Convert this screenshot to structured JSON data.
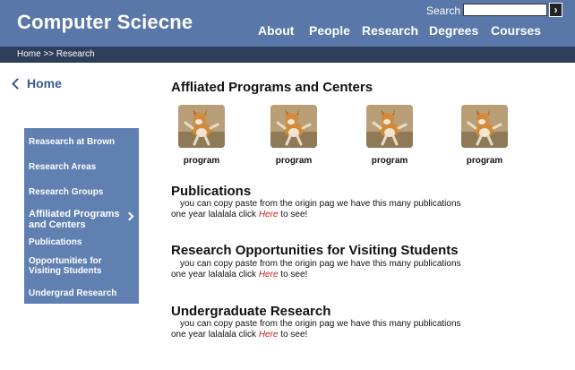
{
  "header": {
    "site_title": "Computer Sciecne",
    "search_label": "Search",
    "search_value": "",
    "search_button_glyph": "›",
    "nav": [
      {
        "label": "About"
      },
      {
        "label": "People"
      },
      {
        "label": "Research"
      },
      {
        "label": "Degrees"
      },
      {
        "label": "Courses"
      }
    ]
  },
  "breadcrumb": "Home >> Research",
  "back_link": "Home",
  "sidebar": {
    "items": [
      {
        "label": "Reasearch at Brown"
      },
      {
        "label": "Research Areas"
      },
      {
        "label": "Research Groups"
      },
      {
        "label": "Affiliated Programs",
        "label2": "and  Centers",
        "active": true
      },
      {
        "label": "Publications"
      },
      {
        "label": "Opportunities for",
        "label2": "Visiting Students"
      },
      {
        "label": "Undergrad  Research"
      }
    ]
  },
  "main": {
    "affiliated": {
      "title": "Affliated Programs and Centers",
      "programs": [
        {
          "label": "program",
          "icon": "dog-photo"
        },
        {
          "label": "program",
          "icon": "dog-photo"
        },
        {
          "label": "program",
          "icon": "dog-photo"
        },
        {
          "label": "program",
          "icon": "dog-photo"
        }
      ]
    },
    "sections": [
      {
        "title": "Publications",
        "line1": "you can copy paste from the origin pag  we have this many publications",
        "line2_pre": "one year lalalala  click ",
        "link": "Here",
        "line2_post": " to see!"
      },
      {
        "title": "Research Opportunities for Visiting Students",
        "line1": "you can copy paste from the origin pag  we have this many publications",
        "line2_pre": "one year lalalala  click ",
        "link": "Here",
        "line2_post": " to see!"
      },
      {
        "title": "Undergraduate Research",
        "line1": "you can copy paste from the origin pag  we have this many publications",
        "line2_pre": "one year lalalala  click ",
        "link": "Here",
        "line2_post": " to see!"
      }
    ]
  },
  "colors": {
    "header_bg": "#5977a8",
    "crumb_bg": "#2c3e5a",
    "sidebar_bg": "#6080b2",
    "link_red": "#c81d1d"
  }
}
